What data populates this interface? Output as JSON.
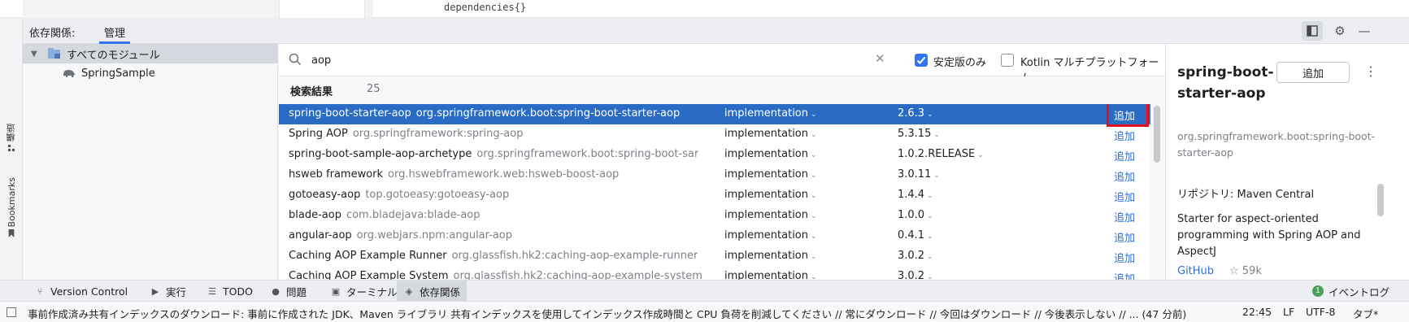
{
  "editor": {
    "code_line": "dependencies{}"
  },
  "side_tabs": {
    "structure": "構造",
    "bookmarks": "Bookmarks"
  },
  "tool_window": {
    "title": "依存関係:",
    "tab": "管理"
  },
  "module_tree": {
    "items": [
      {
        "label": "すべてのモジュール",
        "icon": "module-folder-icon"
      },
      {
        "label": "SpringSample",
        "icon": "elephant-icon"
      }
    ]
  },
  "search": {
    "value": "aop",
    "stable_only_label": "安定版のみ",
    "stable_only_checked": true,
    "kotlin_label": "Kotlin マルチプラットフォーム",
    "kotlin_checked": false
  },
  "results": {
    "title": "検索結果",
    "count": "25",
    "add_label": "追加",
    "rows": [
      {
        "name": "spring-boot-starter-aop",
        "coord": "org.springframework.boot:spring-boot-starter-aop",
        "scope": "implementation",
        "version": "2.6.3",
        "selected": true
      },
      {
        "name": "Spring AOP",
        "coord": "org.springframework:spring-aop",
        "scope": "implementation",
        "version": "5.3.15"
      },
      {
        "name": "spring-boot-sample-aop-archetype",
        "coord": "org.springframework.boot:spring-boot-sar",
        "scope": "implementation",
        "version": "1.0.2.RELEASE"
      },
      {
        "name": "hsweb framework",
        "coord": "org.hswebframework.web:hsweb-boost-aop",
        "scope": "implementation",
        "version": "3.0.11"
      },
      {
        "name": "gotoeasy-aop",
        "coord": "top.gotoeasy:gotoeasy-aop",
        "scope": "implementation",
        "version": "1.4.4"
      },
      {
        "name": "blade-aop",
        "coord": "com.bladejava:blade-aop",
        "scope": "implementation",
        "version": "1.0.0"
      },
      {
        "name": "angular-aop",
        "coord": "org.webjars.npm:angular-aop",
        "scope": "implementation",
        "version": "0.4.1"
      },
      {
        "name": "Caching AOP Example Runner",
        "coord": "org.glassfish.hk2:caching-aop-example-runner",
        "scope": "implementation",
        "version": "3.0.2"
      },
      {
        "name": "Caching AOP Example System",
        "coord": "org.glassfish.hk2:caching-aop-example-system",
        "scope": "implementation",
        "version": "3.0.2"
      }
    ]
  },
  "detail": {
    "title": "spring-boot-starter-aop",
    "add_button": "追加",
    "coord": "org.springframework.boot:spring-boot-starter-aop",
    "repository": "リポジトリ: Maven Central",
    "description": "Starter for aspect-oriented programming with Spring AOP and AspectJ",
    "github": "GitHub",
    "stars": "☆ 59k"
  },
  "bottom_tools": [
    {
      "label": "Version Control",
      "icon": "branch-icon"
    },
    {
      "label": "実行",
      "icon": "run-icon"
    },
    {
      "label": "TODO",
      "icon": "list-icon"
    },
    {
      "label": "問題",
      "icon": "problems-icon"
    },
    {
      "label": "ターミナル",
      "icon": "terminal-icon"
    },
    {
      "label": "依存関係",
      "icon": "layers-icon",
      "active": true
    }
  ],
  "event_log": {
    "count": "1",
    "label": "イベントログ"
  },
  "status": {
    "message": "事前作成済み共有インデックスのダウンロード: 事前に作成された JDK、Maven ライブラリ 共有インデックスを使用してインデックス作成時間と CPU 負荷を削減してください // 常にダウンロード // 今回はダウンロード // 今後表示しない // ... (47 分前)",
    "time": "22:45",
    "line_sep": "LF",
    "encoding": "UTF-8",
    "indent": "タブ*"
  },
  "colors": {
    "accent": "#3574f0",
    "selection": "#2a6cc5",
    "link": "#2f6fd6",
    "highlight_box": "#e0101a"
  }
}
